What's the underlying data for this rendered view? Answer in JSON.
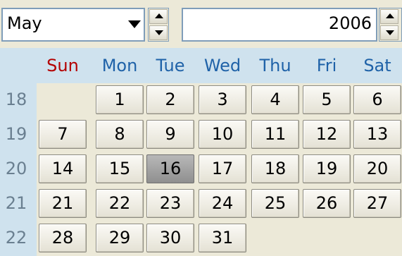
{
  "header": {
    "month": "May",
    "year": "2006"
  },
  "calendar": {
    "day_names": [
      "Sun",
      "Mon",
      "Tue",
      "Wed",
      "Thu",
      "Fri",
      "Sat"
    ],
    "weeks": [
      {
        "number": "18",
        "days": [
          "",
          "1",
          "2",
          "3",
          "4",
          "5",
          "6"
        ]
      },
      {
        "number": "19",
        "days": [
          "7",
          "8",
          "9",
          "10",
          "11",
          "12",
          "13"
        ]
      },
      {
        "number": "20",
        "days": [
          "14",
          "15",
          "16",
          "17",
          "18",
          "19",
          "20"
        ]
      },
      {
        "number": "21",
        "days": [
          "21",
          "22",
          "23",
          "24",
          "25",
          "26",
          "27"
        ]
      },
      {
        "number": "22",
        "days": [
          "28",
          "29",
          "30",
          "31",
          "",
          "",
          ""
        ]
      }
    ],
    "selected_day": "16"
  },
  "colors": {
    "weekday_header": "#1f62a8",
    "sunday_header": "#b40000",
    "header_background": "#cfe2ee",
    "selected_day": "#8f8f8f"
  }
}
